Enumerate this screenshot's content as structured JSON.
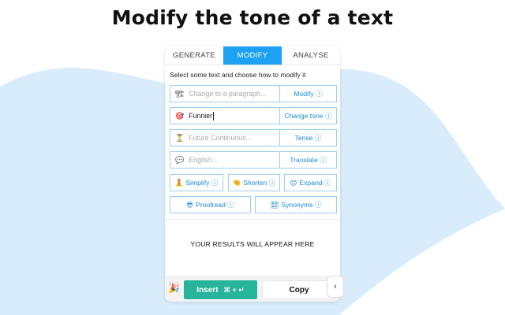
{
  "headline": "Modify the tone of a text",
  "tabs": [
    {
      "label": "GENERATE",
      "active": false
    },
    {
      "label": "MODIFY",
      "active": true
    },
    {
      "label": "ANALYSE",
      "active": false
    }
  ],
  "instruction": "Select some text and choose how to modify it",
  "rows": [
    {
      "icon": "🏗",
      "placeholder": "Change to a paragraph...",
      "value": "",
      "action": "Modify ⓘ"
    },
    {
      "icon": "🎯",
      "placeholder": "",
      "value": "Funnier",
      "action": "Change tone ⓘ"
    },
    {
      "icon": "⏳",
      "placeholder": "Future Continuous...",
      "value": "",
      "action": "Tense ⓘ"
    },
    {
      "icon": "💬",
      "placeholder": "English...",
      "value": "",
      "action": "Translate ⓘ"
    }
  ],
  "quick_actions": {
    "simplify": {
      "icon": "🧘",
      "label": "Simplify ⓘ"
    },
    "shorten": {
      "icon": "🤏",
      "label": "Shorten ⓘ"
    },
    "expand": {
      "icon": "😊",
      "label": "Expand ⓘ"
    },
    "proofread": {
      "icon": "😎",
      "label": "Proofread ⓘ"
    },
    "synonyms": {
      "icon": "🎛",
      "label": "Synonyms ⓘ"
    }
  },
  "results_placeholder": "YOUR RESULTS WILL APPEAR HERE",
  "bottom": {
    "party_icon": "🎉",
    "insert_label": "Insert",
    "insert_shortcut": "⌘ + ↵",
    "copy_label": "Copy",
    "collapse_icon": "‹"
  },
  "colors": {
    "accent": "#1da1f2",
    "insert": "#26b59a",
    "link": "#1a8ad4",
    "background": "#d8ecfb"
  }
}
